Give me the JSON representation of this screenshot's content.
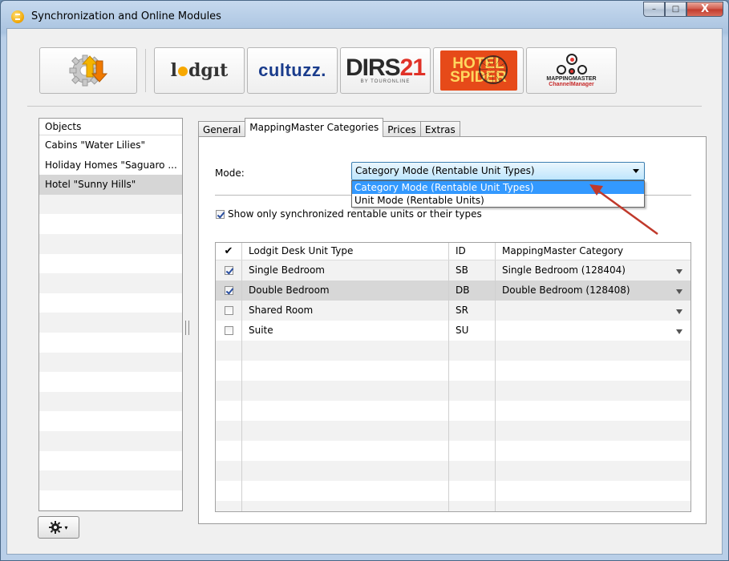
{
  "window": {
    "title": "Synchronization and Online Modules",
    "controls": {
      "minimize": "–",
      "maximize": "□",
      "close": "X"
    }
  },
  "toolbar": {
    "buttons": [
      {
        "name": "sync",
        "icon": "gear-sync-arrows-icon"
      },
      {
        "name": "lodgit",
        "label": "lodgıt"
      },
      {
        "name": "cultuzz",
        "label": "cultuzz."
      },
      {
        "name": "dirs21",
        "label_main": "DIRS",
        "label_num": "21",
        "label_sub": "BY TOURONLINE"
      },
      {
        "name": "hotel-spider",
        "label_line1": "HOTEL",
        "label_line2": "SPIDER"
      },
      {
        "name": "mappingmaster",
        "label_line1": "MAPPINGMASTER",
        "label_line2": "ChannelManager"
      }
    ]
  },
  "objects": {
    "header": "Objects",
    "items": [
      "Cabins \"Water Lilies\"",
      "Holiday Homes \"Saguaro ...",
      "Hotel \"Sunny Hills\""
    ],
    "selected_index": 2
  },
  "gear_menu": {
    "icon": "gear-icon",
    "caret": "▾"
  },
  "tabs": [
    "General",
    "MappingMaster Categories",
    "Prices",
    "Extras"
  ],
  "active_tab": 1,
  "mode": {
    "label": "Mode:",
    "value": "Category Mode (Rentable Unit Types)",
    "options": [
      "Category Mode (Rentable Unit Types)",
      "Unit Mode (Rentable Units)"
    ],
    "highlighted": 0
  },
  "show_sync": {
    "label": "Show only synchronized rentable units or their types",
    "checked": true
  },
  "grid": {
    "headers": {
      "check": "✔",
      "unit_type": "Lodgit Desk Unit Type",
      "id": "ID",
      "category": "MappingMaster Category"
    },
    "rows": [
      {
        "checked": true,
        "unit_type": "Single Bedroom",
        "id": "SB",
        "category": "Single Bedroom (128404)"
      },
      {
        "checked": true,
        "unit_type": "Double Bedroom",
        "id": "DB",
        "category": "Double Bedroom (128408)"
      },
      {
        "checked": false,
        "unit_type": "Shared Room",
        "id": "SR",
        "category": ""
      },
      {
        "checked": false,
        "unit_type": "Suite",
        "id": "SU",
        "category": ""
      }
    ]
  },
  "colors": {
    "highlight": "#3399ff",
    "annotation_arrow": "#c0392b",
    "title_gradient_top": "#c6d9ee"
  }
}
